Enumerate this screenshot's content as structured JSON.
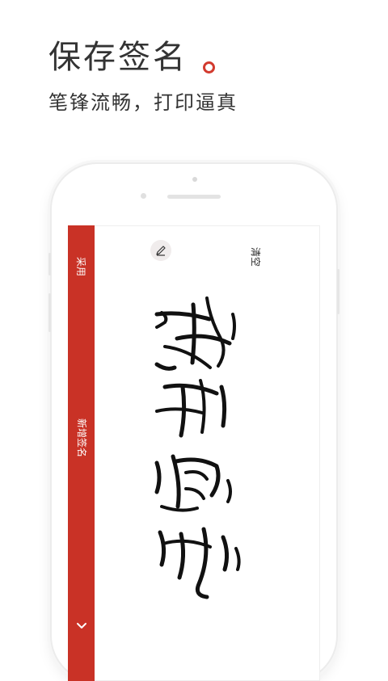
{
  "promo": {
    "headline": "保存签名",
    "subheadline": "笔锋流畅，打印逼真"
  },
  "app": {
    "sidebar": {
      "adopt_label": "采用",
      "new_signature_label": "新增签名",
      "expand_icon": "chevron-down-icon"
    },
    "toolbar": {
      "pen_icon": "pen-icon",
      "clear_label": "清空"
    },
    "colors": {
      "accent": "#c93226",
      "ink": "#111111",
      "text": "#333333"
    }
  }
}
